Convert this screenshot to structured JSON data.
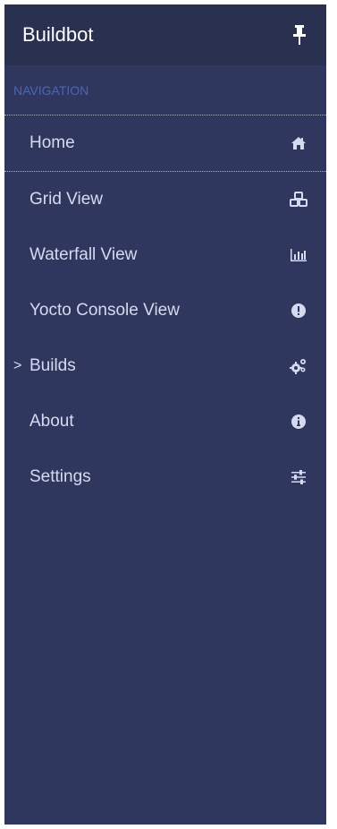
{
  "brand": {
    "title": "Buildbot",
    "pin_icon": "thumbtack-icon"
  },
  "navigation": {
    "header": "NAVIGATION",
    "items": [
      {
        "label": "Home",
        "icon": "home-icon",
        "expandable": false
      },
      {
        "label": "Grid View",
        "icon": "cubes-icon",
        "expandable": false
      },
      {
        "label": "Waterfall View",
        "icon": "bar-chart-icon",
        "expandable": false
      },
      {
        "label": "Yocto Console View",
        "icon": "exclamation-circle-icon",
        "expandable": false
      },
      {
        "label": "Builds",
        "icon": "cogs-icon",
        "expandable": true,
        "caret": ">"
      },
      {
        "label": "About",
        "icon": "info-circle-icon",
        "expandable": false
      },
      {
        "label": "Settings",
        "icon": "sliders-icon",
        "expandable": false
      }
    ]
  },
  "colors": {
    "sidebar_bg": "#30375f",
    "header_bg": "#2a3050",
    "section_label": "#4c66b3",
    "text": "#d6daf0"
  }
}
